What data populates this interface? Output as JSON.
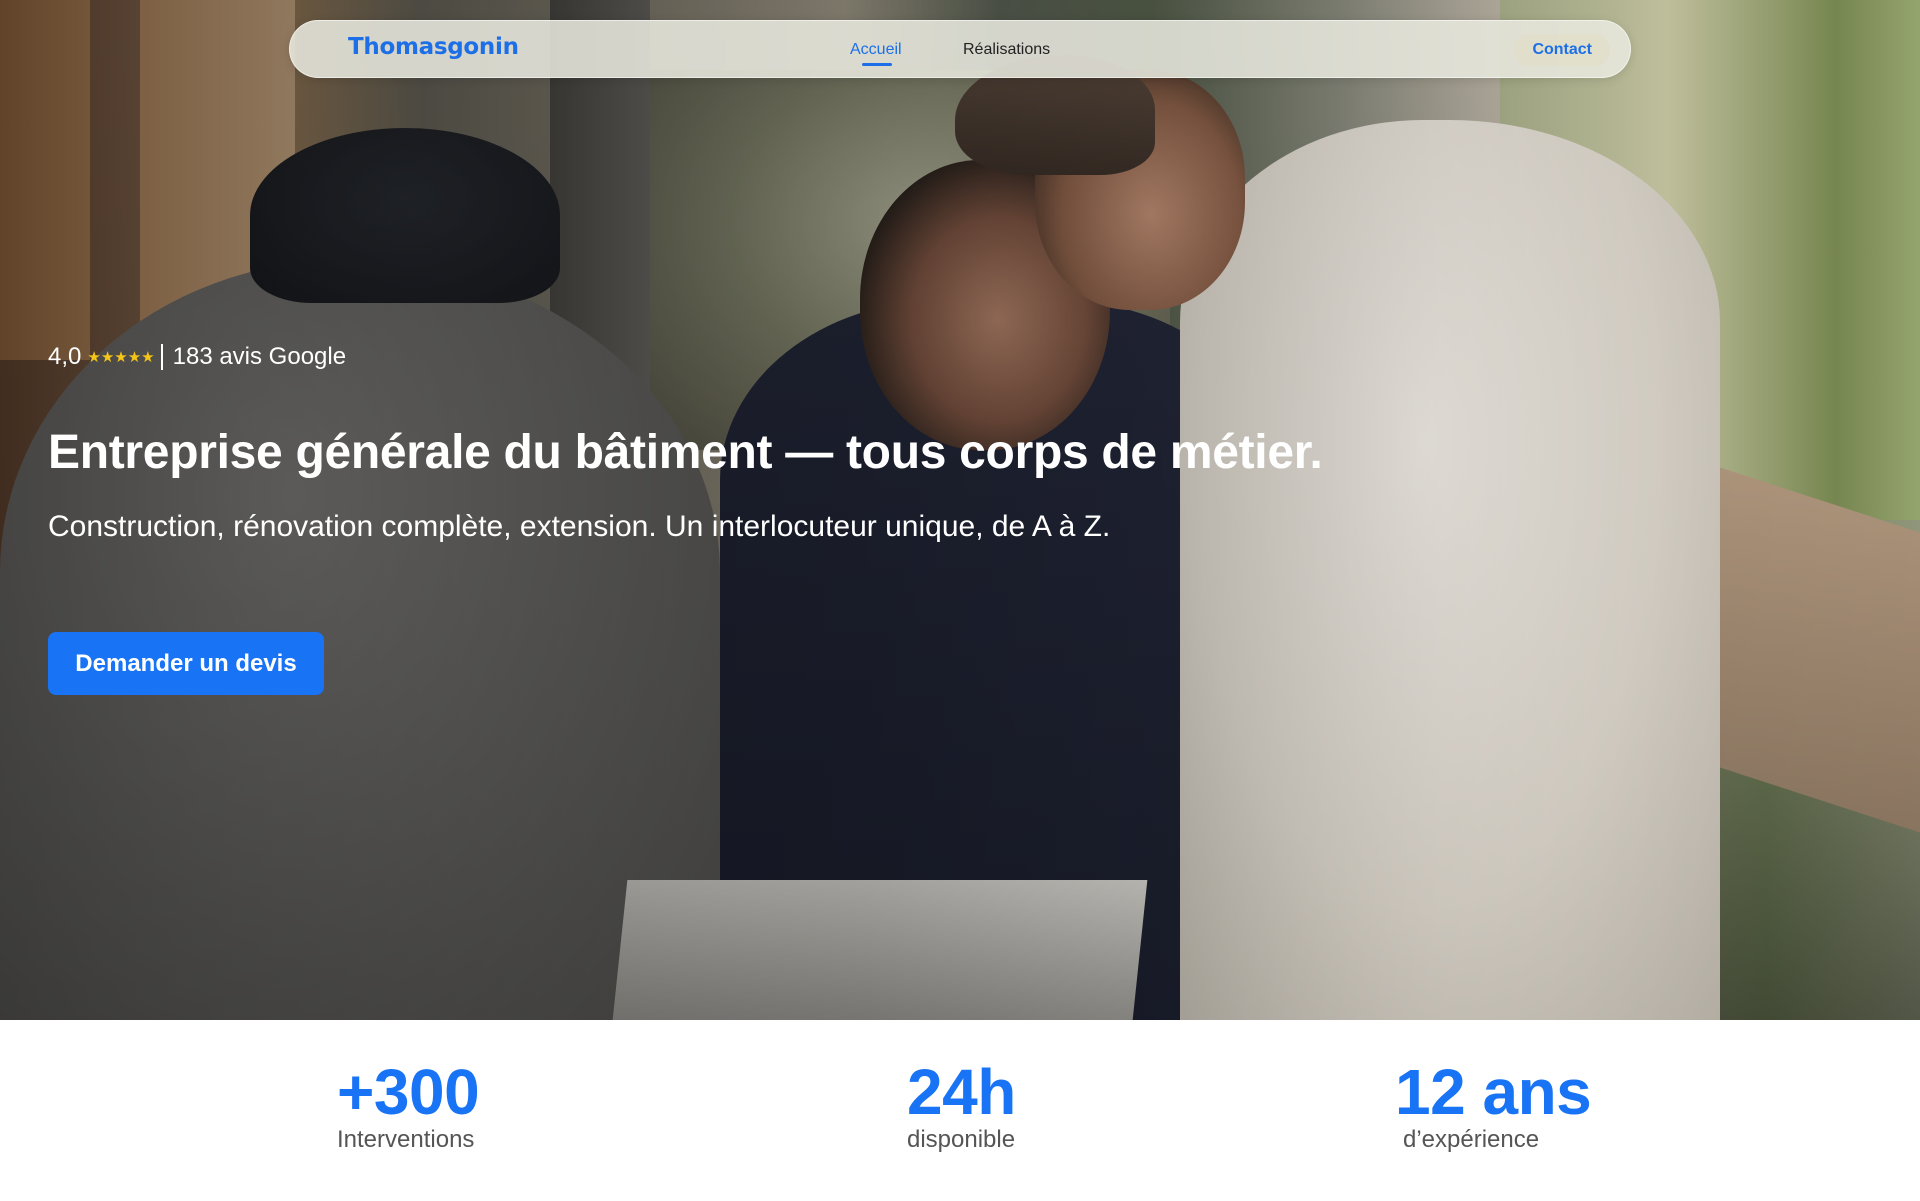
{
  "nav": {
    "logo": "Thomasgonin",
    "links": [
      "Accueil",
      "Réalisations"
    ],
    "contact_label": "Contact"
  },
  "hero": {
    "rating_value": "4,0",
    "stars": "★★★★★",
    "rating_count": "183 avis Google",
    "title": "Entreprise générale du bâtiment — tous corps de métier.",
    "subtitle": "Construction, rénovation complète, extension. Un interlocuteur unique, de A à Z.",
    "cta_label": "Demander un devis"
  },
  "stats": [
    {
      "value": "+300",
      "label": "Interventions"
    },
    {
      "value": "24h",
      "label": "disponible"
    },
    {
      "value": "12 ans",
      "label": "d’expérience"
    }
  ],
  "colors": {
    "accent": "#1873f5",
    "star": "#f5c518",
    "stat_label": "#555555"
  }
}
